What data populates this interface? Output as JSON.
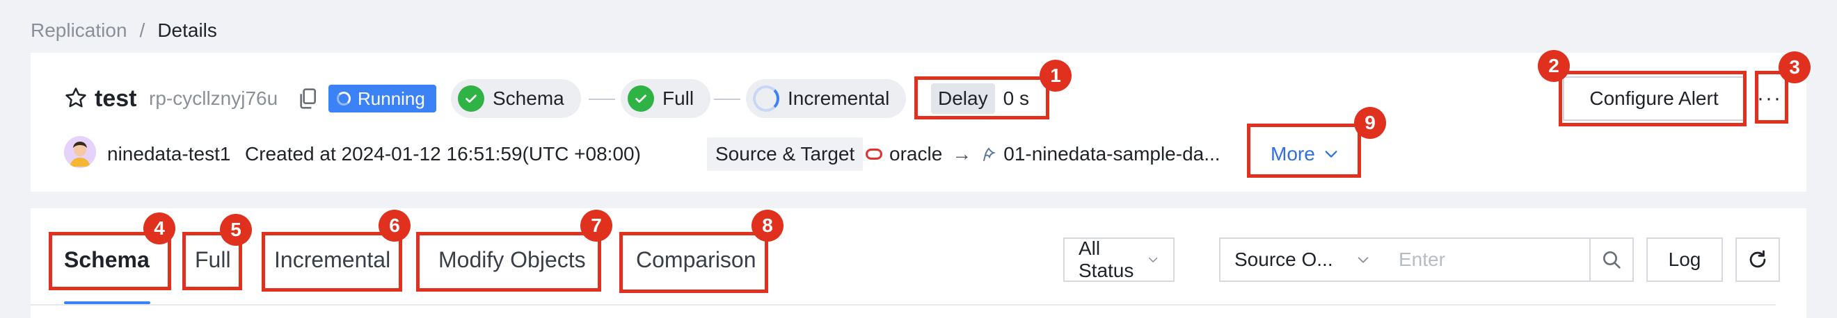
{
  "breadcrumb": {
    "parent": "Replication",
    "separator": "/",
    "current": "Details"
  },
  "task": {
    "name": "test",
    "id": "rp-cycllznyj76u",
    "status": "Running",
    "stages": [
      "Schema",
      "Full",
      "Incremental"
    ],
    "delay_label": "Delay",
    "delay_value": "0 s",
    "creator": "ninedata-test1",
    "created_at": "Created at 2024-01-12 16:51:59(UTC +08:00)",
    "source_target_label": "Source & Target",
    "source": "oracle",
    "target": "01-ninedata-sample-da...",
    "more_label": "More"
  },
  "actions": {
    "configure_alert": "Configure Alert",
    "more_dots": "···"
  },
  "tabs": [
    "Schema",
    "Full",
    "Incremental",
    "Modify Objects",
    "Comparison"
  ],
  "filters": {
    "status_select": "All Status",
    "source_select": "Source O...",
    "search_placeholder": "Enter",
    "log_label": "Log"
  },
  "annotations": [
    "1",
    "2",
    "3",
    "4",
    "5",
    "6",
    "7",
    "8",
    "9"
  ],
  "colors": {
    "accent": "#3b82f6",
    "success": "#2fb344",
    "annotation": "#e0301e"
  }
}
